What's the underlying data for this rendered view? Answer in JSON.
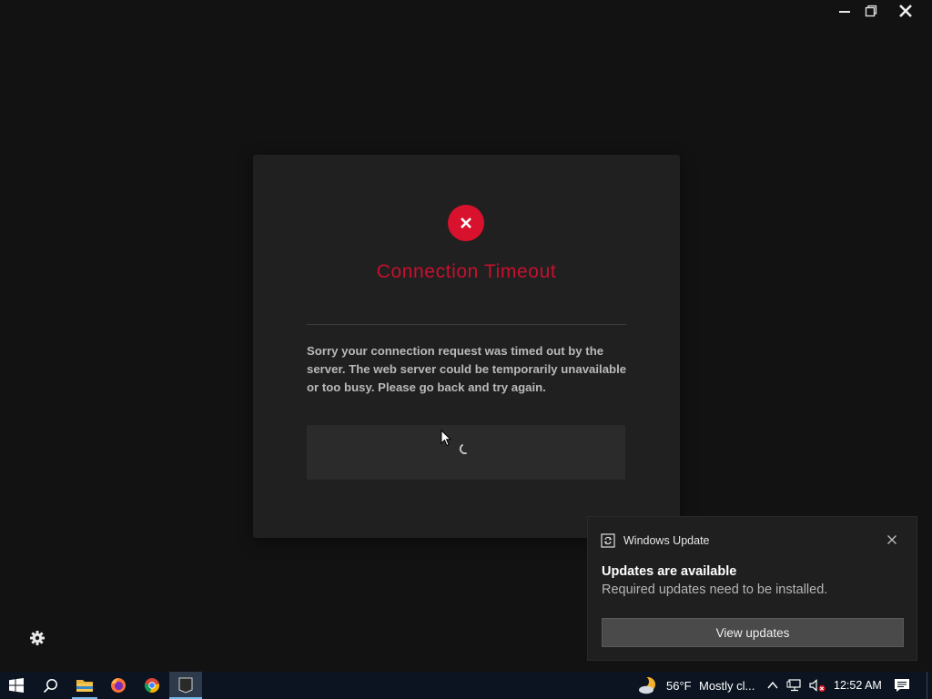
{
  "window": {
    "controls": [
      "minimize",
      "restore",
      "close"
    ]
  },
  "dialog": {
    "title": "Connection Timeout",
    "message": "Sorry your connection request was timed out by the server. The web server could be temporarily unavailable or too busy. Please go back and try again.",
    "icon": "error-x-icon",
    "button_state": "loading",
    "accent_color": "#c8102e"
  },
  "toast": {
    "app_name": "Windows Update",
    "title": "Updates are available",
    "body": "Required updates need to be installed.",
    "button_label": "View updates"
  },
  "taskbar": {
    "pinned": [
      "start-icon",
      "search-icon",
      "file-explorer-icon",
      "firefox-icon",
      "chrome-icon",
      "epic-games-icon"
    ],
    "epic_label": "EPIC",
    "weather_temp": "56°F",
    "weather_desc": "Mostly cl...",
    "clock": "12:52 AM"
  }
}
